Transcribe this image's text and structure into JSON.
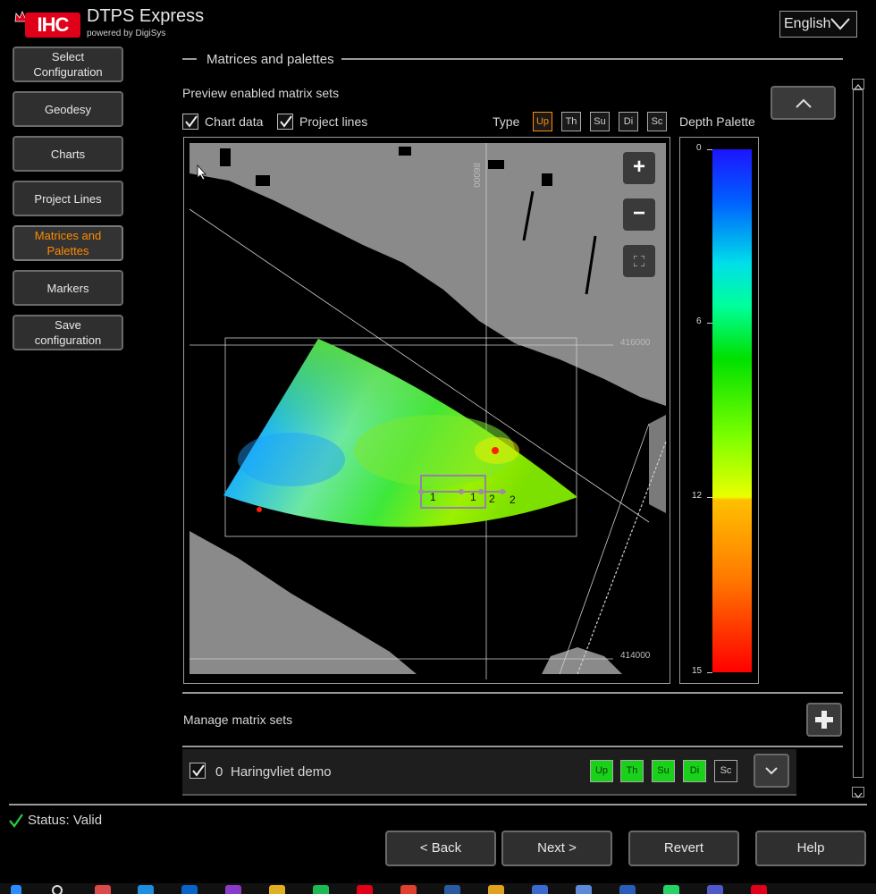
{
  "header": {
    "logo_text": "IHC",
    "app_title": "DTPS Express",
    "app_subtitle": "powered by DigiSys",
    "language": "English"
  },
  "sidebar": {
    "items": [
      {
        "label": "Select Configuration"
      },
      {
        "label": "Geodesy"
      },
      {
        "label": "Charts"
      },
      {
        "label": "Project Lines"
      },
      {
        "label": "Matrices and Palettes",
        "active": true
      },
      {
        "label": "Markers"
      },
      {
        "label": "Save configuration"
      }
    ]
  },
  "main": {
    "section_title": "Matrices and palettes",
    "preview_label": "Preview enabled matrix sets",
    "chart_data_label": "Chart data",
    "chart_data_checked": true,
    "project_lines_label": "Project lines",
    "project_lines_checked": true,
    "type_label": "Type",
    "types": [
      "Up",
      "Th",
      "Su",
      "Di",
      "Sc"
    ],
    "selected_type": "Up",
    "depth_palette_label": "Depth Palette",
    "map": {
      "grid_labels": {
        "x": "86000",
        "y_top": "416000",
        "y_bottom": "414000"
      },
      "line_markers": [
        "1",
        "1",
        "2",
        "2"
      ],
      "zoom_in": "+",
      "zoom_out": "−"
    },
    "palette": {
      "ticks": [
        "0",
        "6",
        "12",
        "15"
      ],
      "colors": [
        "#1c14ff",
        "#00e0e8",
        "#00e000",
        "#eaff00",
        "#ffc000",
        "#ff0000"
      ]
    },
    "manage_label": "Manage matrix sets",
    "matrix_set": {
      "checked": true,
      "index": "0",
      "name": "Haringvliet demo",
      "types": [
        "Up",
        "Th",
        "Su",
        "Di",
        "Sc"
      ],
      "enabled": [
        true,
        true,
        true,
        true,
        false
      ]
    }
  },
  "status": {
    "text": "Status: Valid",
    "color": "#2ecc40"
  },
  "footer": {
    "back": "< Back",
    "next": "Next >",
    "revert": "Revert",
    "help": "Help"
  }
}
